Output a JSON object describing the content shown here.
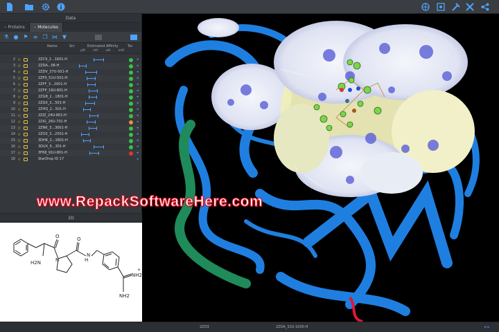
{
  "topbar": {
    "left_icons": [
      "file-icon",
      "folder-icon",
      "settings-icon",
      "info-icon"
    ],
    "right_icons": [
      "globe-icon",
      "network-icon",
      "document-icon",
      "tools-icon",
      "wrench-icon",
      "share-icon"
    ]
  },
  "data_panel": {
    "title": "Data",
    "tabs": [
      "Proteins",
      "Molecules"
    ],
    "active_tab": "Molecules",
    "tools": [
      "flask-icon",
      "drop-icon",
      "flag-icon",
      "stack-icon",
      "copy-icon",
      "tree-icon",
      "filter-icon"
    ],
    "columns": {
      "name": "Name",
      "src": "Src",
      "affinity": "Estimated Affinity",
      "tor": "Tor.",
      "units": [
        "pM",
        "nM",
        "uM",
        "mM"
      ]
    },
    "rows": [
      {
        "n": "2",
        "name": "2ZC9_2...1601-H",
        "lo": 0.35,
        "hi": 0.55,
        "status": "green"
      },
      {
        "n": "3",
        "name": "2ZDA...06-H",
        "lo": 0.08,
        "hi": 0.22,
        "status": "green"
      },
      {
        "n": "4",
        "name": "2ZDV_37U-501-H",
        "lo": 0.2,
        "hi": 0.42,
        "status": "green"
      },
      {
        "n": "5",
        "name": "2ZF0_51U-501-H",
        "lo": 0.22,
        "hi": 0.4,
        "status": "green"
      },
      {
        "n": "6",
        "name": "2ZFF_3...2001-H",
        "lo": 0.24,
        "hi": 0.4,
        "status": "green"
      },
      {
        "n": "7",
        "name": "2ZFP_19U-801-H",
        "lo": 0.26,
        "hi": 0.44,
        "status": "green"
      },
      {
        "n": "8",
        "name": "2ZGB_2...1801-H",
        "lo": 0.26,
        "hi": 0.42,
        "status": "green"
      },
      {
        "n": "9",
        "name": "2ZGX_2...501-H",
        "lo": 0.2,
        "hi": 0.38,
        "status": "green"
      },
      {
        "n": "10",
        "name": "2ZHQ_2...501-H",
        "lo": 0.16,
        "hi": 0.3,
        "status": "green"
      },
      {
        "n": "11",
        "name": "2ZIZ_24U-801-H",
        "lo": 0.28,
        "hi": 0.45,
        "status": "green"
      },
      {
        "n": "12",
        "name": "2ZIG_26U-701-H",
        "lo": 0.22,
        "hi": 0.4,
        "status": "orange"
      },
      {
        "n": "13",
        "name": "2ZNK_3...3001-H",
        "lo": 0.26,
        "hi": 0.42,
        "status": "green"
      },
      {
        "n": "14",
        "name": "2ZO3_3...2501-H",
        "lo": 0.12,
        "hi": 0.28,
        "status": "green"
      },
      {
        "n": "15",
        "name": "3DHK_2...1601-H",
        "lo": 0.16,
        "hi": 0.3,
        "status": "green"
      },
      {
        "n": "16",
        "name": "3DUX_6...301-H",
        "lo": 0.36,
        "hi": 0.55,
        "status": "green"
      },
      {
        "n": "17",
        "name": "3F68_91U-801-H",
        "lo": 0.28,
        "hi": 0.46,
        "status": "red"
      },
      {
        "n": "18",
        "name": "StarDrop ID 17",
        "lo": null,
        "hi": null,
        "status": ""
      }
    ]
  },
  "panel_2d": {
    "title": "2D",
    "atom_labels": [
      "H2N",
      "O",
      "N",
      "O",
      "H",
      "N",
      "NH2",
      "NH2",
      "+"
    ]
  },
  "watermark": "www.RepackSoftwareHere.com",
  "statusbar": {
    "left": "2ZO3",
    "mid": "2ZDA_32U-1000-H"
  },
  "colors": {
    "accent": "#4da3ff",
    "green": "#3cc04a",
    "orange": "#e8913a",
    "red": "#e0362f",
    "ribbon_blue": "#1f7fe0",
    "ribbon_green": "#1f8a5a",
    "surface_white": "#e8edf5",
    "surface_blue": "#5a5fd6",
    "surface_yellow": "#efeeb9",
    "ligand_green": "#7fd34d",
    "watermark_red": "#e0162b"
  }
}
